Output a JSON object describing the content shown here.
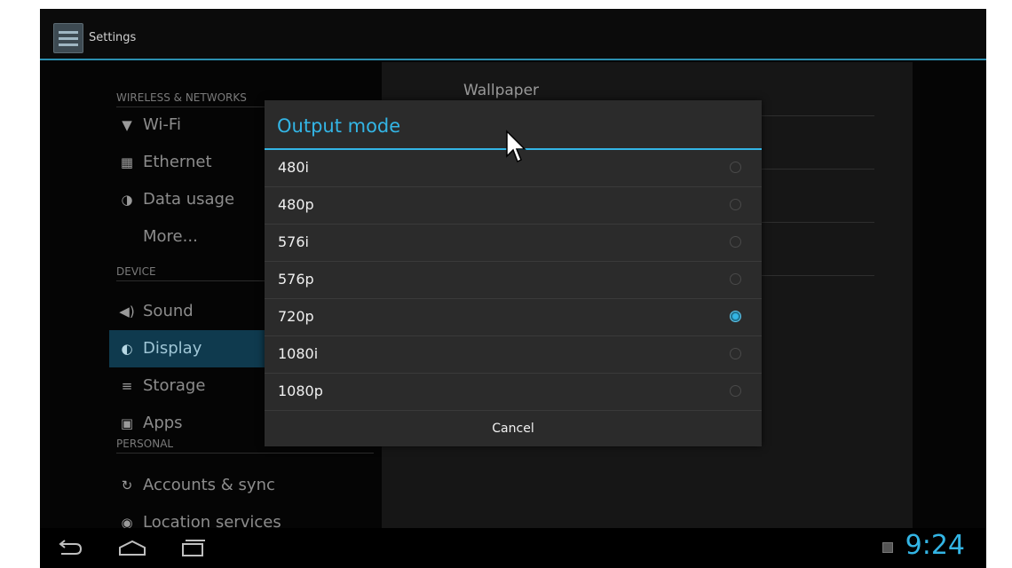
{
  "app": {
    "title": "Settings"
  },
  "sidebar": {
    "categories": [
      "WIRELESS & NETWORKS",
      "DEVICE",
      "PERSONAL"
    ],
    "items": [
      {
        "label": "Wi-Fi",
        "icon": "wifi-icon",
        "glyph": "▼"
      },
      {
        "label": "Ethernet",
        "icon": "ethernet-icon",
        "glyph": "▦"
      },
      {
        "label": "Data usage",
        "icon": "data-usage-icon",
        "glyph": "◑"
      },
      {
        "label": "More...",
        "icon": "",
        "glyph": ""
      },
      {
        "label": "Sound",
        "icon": "sound-icon",
        "glyph": "◀)"
      },
      {
        "label": "Display",
        "icon": "display-icon",
        "glyph": "◐"
      },
      {
        "label": "Storage",
        "icon": "storage-icon",
        "glyph": "≡"
      },
      {
        "label": "Apps",
        "icon": "apps-icon",
        "glyph": "▣"
      },
      {
        "label": "Accounts & sync",
        "icon": "sync-icon",
        "glyph": "↻"
      },
      {
        "label": "Location services",
        "icon": "location-icon",
        "glyph": "◉"
      }
    ],
    "selected": "Display"
  },
  "content": {
    "first_row": "Wallpaper"
  },
  "dialog": {
    "title": "Output mode",
    "options": [
      {
        "label": "480i",
        "selected": false
      },
      {
        "label": "480p",
        "selected": false
      },
      {
        "label": "576i",
        "selected": false
      },
      {
        "label": "576p",
        "selected": false
      },
      {
        "label": "720p",
        "selected": true
      },
      {
        "label": "1080i",
        "selected": false
      },
      {
        "label": "1080p",
        "selected": false
      }
    ],
    "cancel_label": "Cancel"
  },
  "status": {
    "time": "9:24"
  },
  "colors": {
    "accent": "#33b5e5",
    "selected_bg": "#0f3a4e"
  }
}
